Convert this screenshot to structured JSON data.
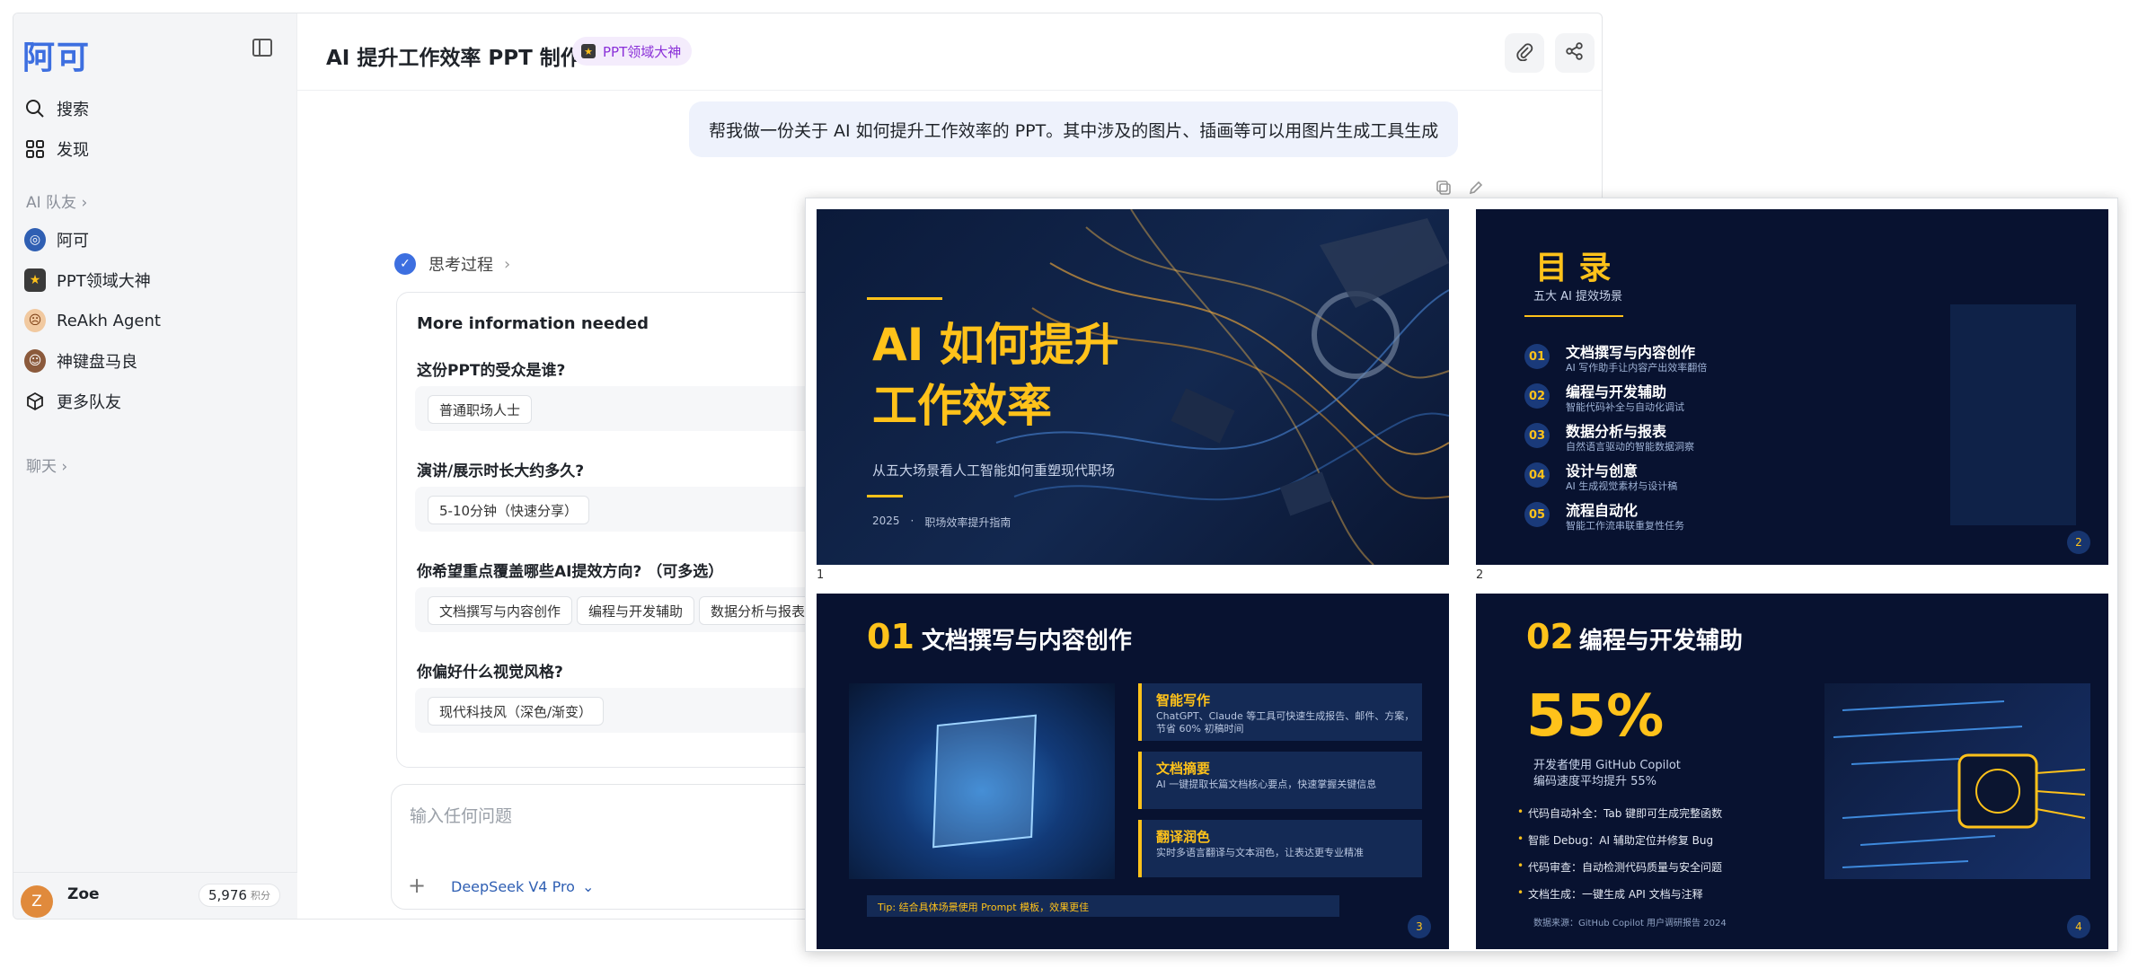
{
  "app": {
    "logo": "阿可",
    "title": "AI 提升工作效率 PPT 制作",
    "badge": "PPT领域大神"
  },
  "sidebar": {
    "nav": [
      {
        "label": "搜索",
        "icon": "search-icon"
      },
      {
        "label": "发现",
        "icon": "grid-icon"
      }
    ],
    "team_section": "AI 队友",
    "teammates": [
      {
        "label": "阿可",
        "icon": "ake-avatar"
      },
      {
        "label": "PPT领域大神",
        "icon": "ppt-avatar"
      },
      {
        "label": "ReAkh Agent",
        "icon": "reakh-avatar"
      },
      {
        "label": "神键盘马良",
        "icon": "keyboard-avatar"
      },
      {
        "label": "更多队友",
        "icon": "cube-icon"
      }
    ],
    "chat_section": "聊天",
    "user": {
      "initial": "Z",
      "name": "Zoe",
      "points": "5,976",
      "points_unit": "积分"
    }
  },
  "chat": {
    "user_message": "帮我做一份关于 AI 如何提升工作效率的 PPT。其中涉及的图片、插画等可以用图片生成工具生成",
    "thinking_label": "思考过程",
    "card": {
      "title": "More information needed",
      "questions": [
        {
          "q": "这份PPT的受众是谁?",
          "options": [
            "普通职场人士"
          ]
        },
        {
          "q": "演讲/展示时长大约多久?",
          "options": [
            "5-10分钟（快速分享）"
          ]
        },
        {
          "q": "你希望重点覆盖哪些AI提效方向?  （可多选）",
          "options": [
            "文档撰写与内容创作",
            "编程与开发辅助",
            "数据分析与报表"
          ]
        },
        {
          "q": "你偏好什么视觉风格?",
          "options": [
            "现代科技风（深色/渐变）"
          ]
        }
      ]
    },
    "input_placeholder": "输入任何问题",
    "model": "DeepSeek V4 Pro"
  },
  "slides": {
    "s1": {
      "num": "1",
      "title1": "AI 如何提升",
      "title2": "工作效率",
      "sub": "从五大场景看人工智能如何重塑现代职场",
      "year": "2025",
      "sep": "·",
      "tag": "职场效率提升指南"
    },
    "s2": {
      "num": "2",
      "title": "目  录",
      "sub": "五大 AI 提效场景",
      "page": "2",
      "items": [
        {
          "n": "01",
          "t": "文档撰写与内容创作",
          "s": "AI 写作助手让内容产出效率翻倍"
        },
        {
          "n": "02",
          "t": "编程与开发辅助",
          "s": "智能代码补全与自动化调试"
        },
        {
          "n": "03",
          "t": "数据分析与报表",
          "s": "自然语言驱动的智能数据洞察"
        },
        {
          "n": "04",
          "t": "设计与创意",
          "s": "AI 生成视觉素材与设计稿"
        },
        {
          "n": "05",
          "t": "流程自动化",
          "s": "智能工作流串联重复性任务"
        }
      ]
    },
    "s3": {
      "num": "3",
      "no": "01",
      "title": "文档撰写与内容创作",
      "page": "3",
      "boxes": [
        {
          "t": "智能写作",
          "s": "ChatGPT、Claude 等工具可快速生成报告、邮件、方案，节省 60% 初稿时间"
        },
        {
          "t": "文档摘要",
          "s": "AI 一键提取长篇文档核心要点，快速掌握关键信息"
        },
        {
          "t": "翻译润色",
          "s": "实时多语言翻译与文本润色，让表达更专业精准"
        }
      ],
      "tip": "Tip: 结合具体场景使用 Prompt 模板，效果更佳"
    },
    "s4": {
      "num": "4",
      "no": "02",
      "title": "编程与开发辅助",
      "page": "4",
      "big": "55%",
      "desc1": "开发者使用 GitHub Copilot",
      "desc2": "编码速度平均提升 55%",
      "bullets": [
        "代码自动补全：Tab 键即可生成完整函数",
        "智能 Debug：AI 辅助定位并修复 Bug",
        "代码审查：自动检测代码质量与安全问题",
        "文档生成：一键生成 API 文档与注释"
      ],
      "source": "数据来源：GitHub Copilot 用户调研报告 2024"
    }
  }
}
